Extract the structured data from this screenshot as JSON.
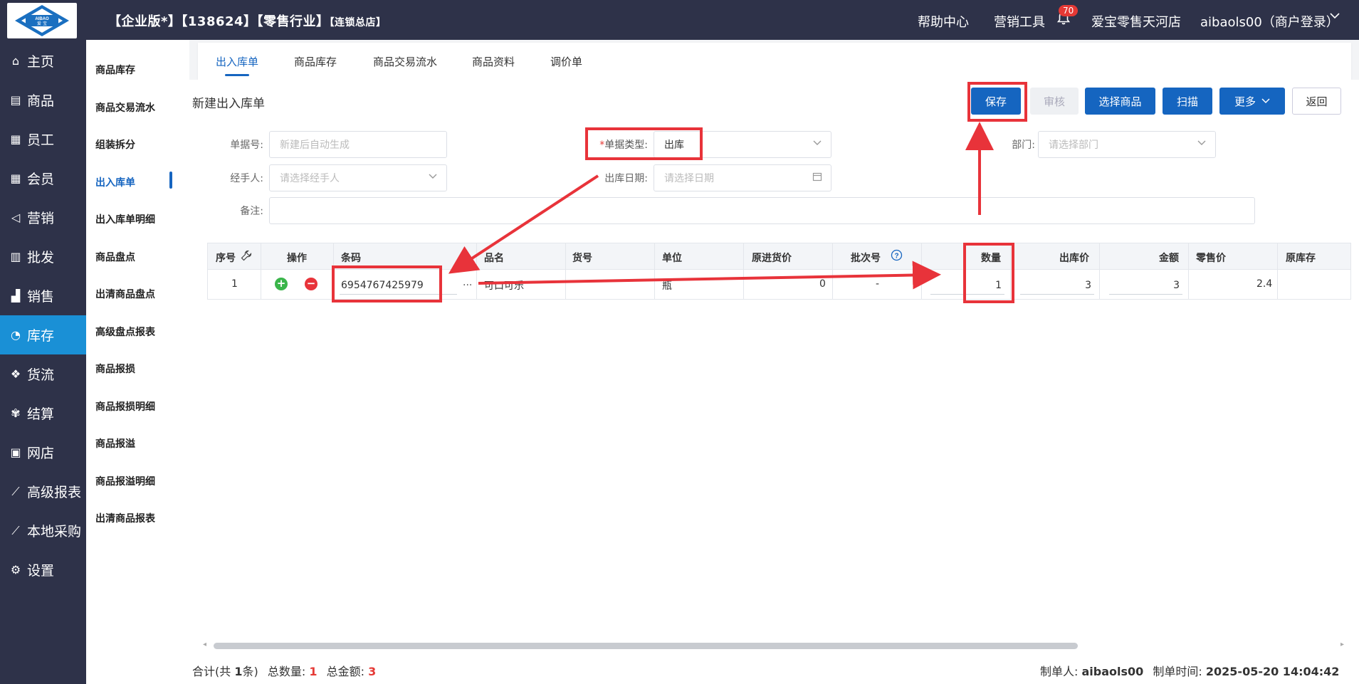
{
  "header": {
    "edition": "【企业版*】【138624】【零售行业】",
    "store_type": "【连锁总店】",
    "help": "帮助中心",
    "marketing": "营销工具",
    "notifications": "70",
    "store_name": "爱宝零售天河店",
    "account": "aibaols00（商户登录）",
    "logo_text": "AIBAO 爱宝"
  },
  "leftnav": [
    {
      "label": "主页",
      "icon": "home-icon"
    },
    {
      "label": "商品",
      "icon": "box-icon"
    },
    {
      "label": "员工",
      "icon": "staff-icon"
    },
    {
      "label": "会员",
      "icon": "member-icon"
    },
    {
      "label": "营销",
      "icon": "megaphone-icon"
    },
    {
      "label": "批发",
      "icon": "wholesale-icon"
    },
    {
      "label": "销售",
      "icon": "chart-bar-icon"
    },
    {
      "label": "库存",
      "icon": "pie-chart-icon"
    },
    {
      "label": "货流",
      "icon": "cube-icon"
    },
    {
      "label": "结算",
      "icon": "settle-icon"
    },
    {
      "label": "网店",
      "icon": "gift-icon"
    },
    {
      "label": "高级报表",
      "icon": "line-chart-icon"
    },
    {
      "label": "本地采购",
      "icon": "trend-icon"
    },
    {
      "label": "设置",
      "icon": "gear-icon"
    }
  ],
  "subnav": [
    "商品库存",
    "商品交易流水",
    "组装拆分",
    "出入库单",
    "出入库单明细",
    "商品盘点",
    "出清商品盘点",
    "高级盘点报表",
    "商品报损",
    "商品报损明细",
    "商品报溢",
    "商品报溢明细",
    "出清商品报表"
  ],
  "tabs": [
    "出入库单",
    "商品库存",
    "商品交易流水",
    "商品资料",
    "调价单"
  ],
  "page_title": "新建出入库单",
  "buttons": {
    "save": "保存",
    "audit": "审核",
    "select_goods": "选择商品",
    "scan": "扫描",
    "more": "更多",
    "back": "返回"
  },
  "form": {
    "doc_no_label": "单据号:",
    "doc_no_placeholder": "新建后自动生成",
    "doc_type_label": "单据类型:",
    "doc_type_value": "出库",
    "dept_label": "部门:",
    "dept_placeholder": "请选择部门",
    "handler_label": "经手人:",
    "handler_placeholder": "请选择经手人",
    "date_label": "出库日期:",
    "date_placeholder": "请选择日期",
    "remark_label": "备注:"
  },
  "table": {
    "headers": [
      "序号",
      "操作",
      "条码",
      "品名",
      "货号",
      "单位",
      "原进货价",
      "批次号",
      "数量",
      "出库价",
      "金额",
      "零售价",
      "原库存"
    ],
    "rows": [
      {
        "seq": "1",
        "barcode": "6954767425979",
        "name": "可口可乐",
        "sku": "",
        "unit": "瓶",
        "orig_price": "0",
        "batch": "-",
        "qty": "1",
        "out_price": "3",
        "amount": "3",
        "retail": "2.4",
        "stock": ""
      }
    ],
    "ellipsis": "..."
  },
  "footer": {
    "summary_prefix": "合计(共 ",
    "summary_count": "1",
    "summary_suffix": "条)",
    "total_qty_label": "总数量:",
    "total_qty": "1",
    "total_amount_label": "总金额:",
    "total_amount": "3",
    "creator_label": "制单人:",
    "creator": "aibaols00",
    "time_label": "制单时间:",
    "time": "2025-05-20 14:04:42"
  },
  "colors": {
    "topbar": "#2e3249",
    "active_nav": "#1a90d6",
    "primary": "#1565c0",
    "annotation": "#e8333a"
  }
}
